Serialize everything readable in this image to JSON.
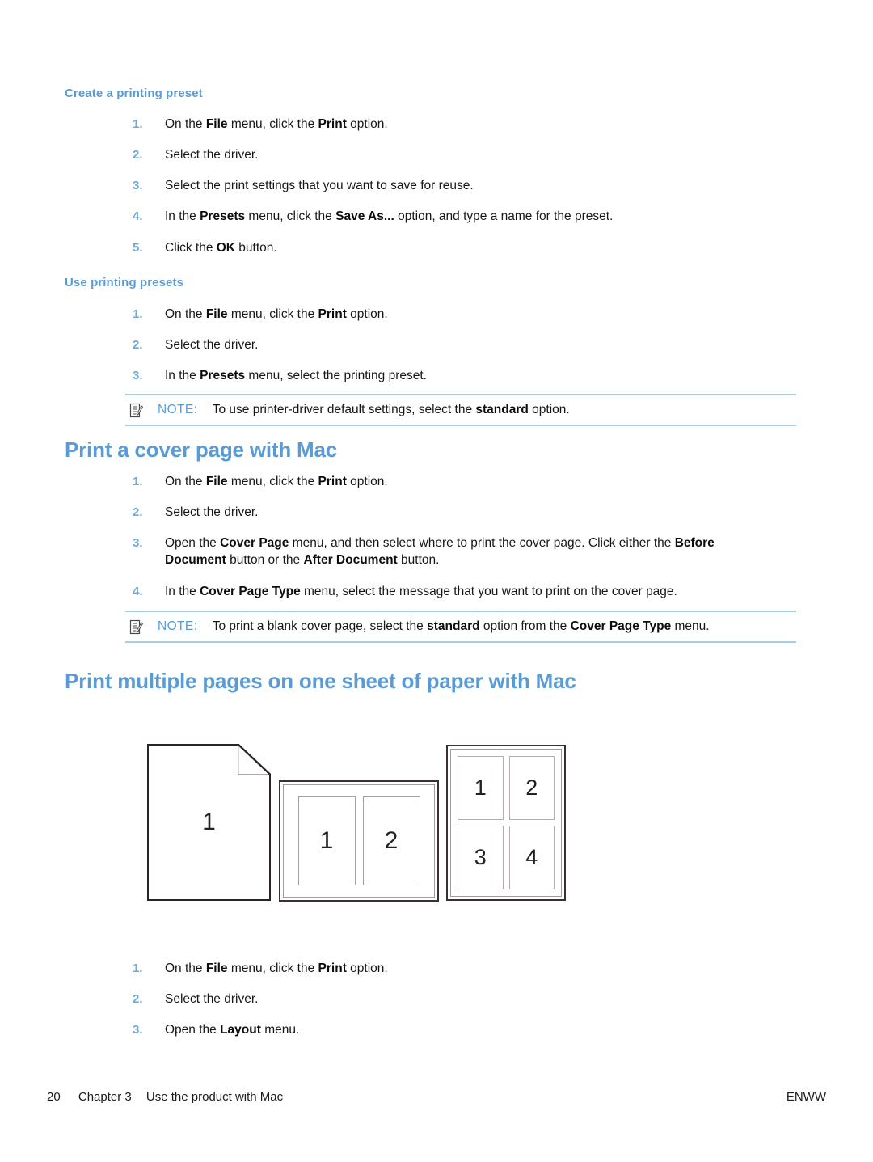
{
  "document": {
    "footer": {
      "page_number": "20",
      "chapter": "Chapter 3",
      "chapter_title": "Use the product with Mac",
      "right_label": "ENWW"
    },
    "colors": {
      "heading_blue": "#5B9BD5",
      "list_number_blue": "#6FA8DC",
      "note_rule_blue": "#A8CBE8"
    }
  },
  "sections": [
    {
      "id": "create-preset",
      "level": "h3",
      "heading": "Create a printing preset",
      "steps": [
        {
          "num": "1.",
          "html": "On the <b>File</b> menu, click the <b>Print</b> option."
        },
        {
          "num": "2.",
          "html": "Select the driver."
        },
        {
          "num": "3.",
          "html": "Select the print settings that you want to save for reuse."
        },
        {
          "num": "4.",
          "html": "In the <b>Presets</b> menu, click the <b>Save As...</b> option, and type a name for the preset."
        },
        {
          "num": "5.",
          "html": "Click the <b>OK</b> button."
        }
      ]
    },
    {
      "id": "use-presets",
      "level": "h3",
      "heading": "Use printing presets",
      "steps": [
        {
          "num": "1.",
          "html": "On the <b>File</b> menu, click the <b>Print</b> option."
        },
        {
          "num": "2.",
          "html": "Select the driver."
        },
        {
          "num": "3.",
          "html": "In the <b>Presets</b> menu, select the printing preset."
        }
      ],
      "note": {
        "label": "NOTE:",
        "html": "To use printer-driver default settings, select the <b>standard</b> option."
      }
    },
    {
      "id": "cover-page",
      "level": "h2",
      "heading": "Print a cover page with Mac",
      "steps": [
        {
          "num": "1.",
          "html": "On the <b>File</b> menu, click the <b>Print</b> option."
        },
        {
          "num": "2.",
          "html": "Select the driver."
        },
        {
          "num": "3.",
          "html": "Open the <b>Cover Page</b> menu, and then select where to print the cover page. Click either the <b>Before Document</b> button or the <b>After Document</b> button."
        },
        {
          "num": "4.",
          "html": "In the <b>Cover Page Type</b> menu, select the message that you want to print on the cover page."
        }
      ],
      "note": {
        "label": "NOTE:",
        "html": "To print a blank cover page, select the <b>standard</b> option from the <b>Cover Page Type</b> menu."
      }
    },
    {
      "id": "multiple-pages",
      "level": "h2",
      "heading": "Print multiple pages on one sheet of paper with Mac",
      "steps": [
        {
          "num": "1.",
          "html": "On the <b>File</b> menu, click the <b>Print</b> option."
        },
        {
          "num": "2.",
          "html": "Select the driver."
        },
        {
          "num": "3.",
          "html": "Open the <b>Layout</b> menu."
        }
      ]
    }
  ],
  "figure": {
    "name": "n-up-printing-illustration",
    "panels": [
      {
        "id": "one-up",
        "type": "single-page-folded-corner",
        "labels": [
          "1"
        ]
      },
      {
        "id": "two-up",
        "type": "landscape-sheet",
        "labels": [
          "1",
          "2"
        ]
      },
      {
        "id": "four-up",
        "type": "portrait-sheet",
        "labels": [
          "1",
          "2",
          "3",
          "4"
        ]
      }
    ]
  }
}
